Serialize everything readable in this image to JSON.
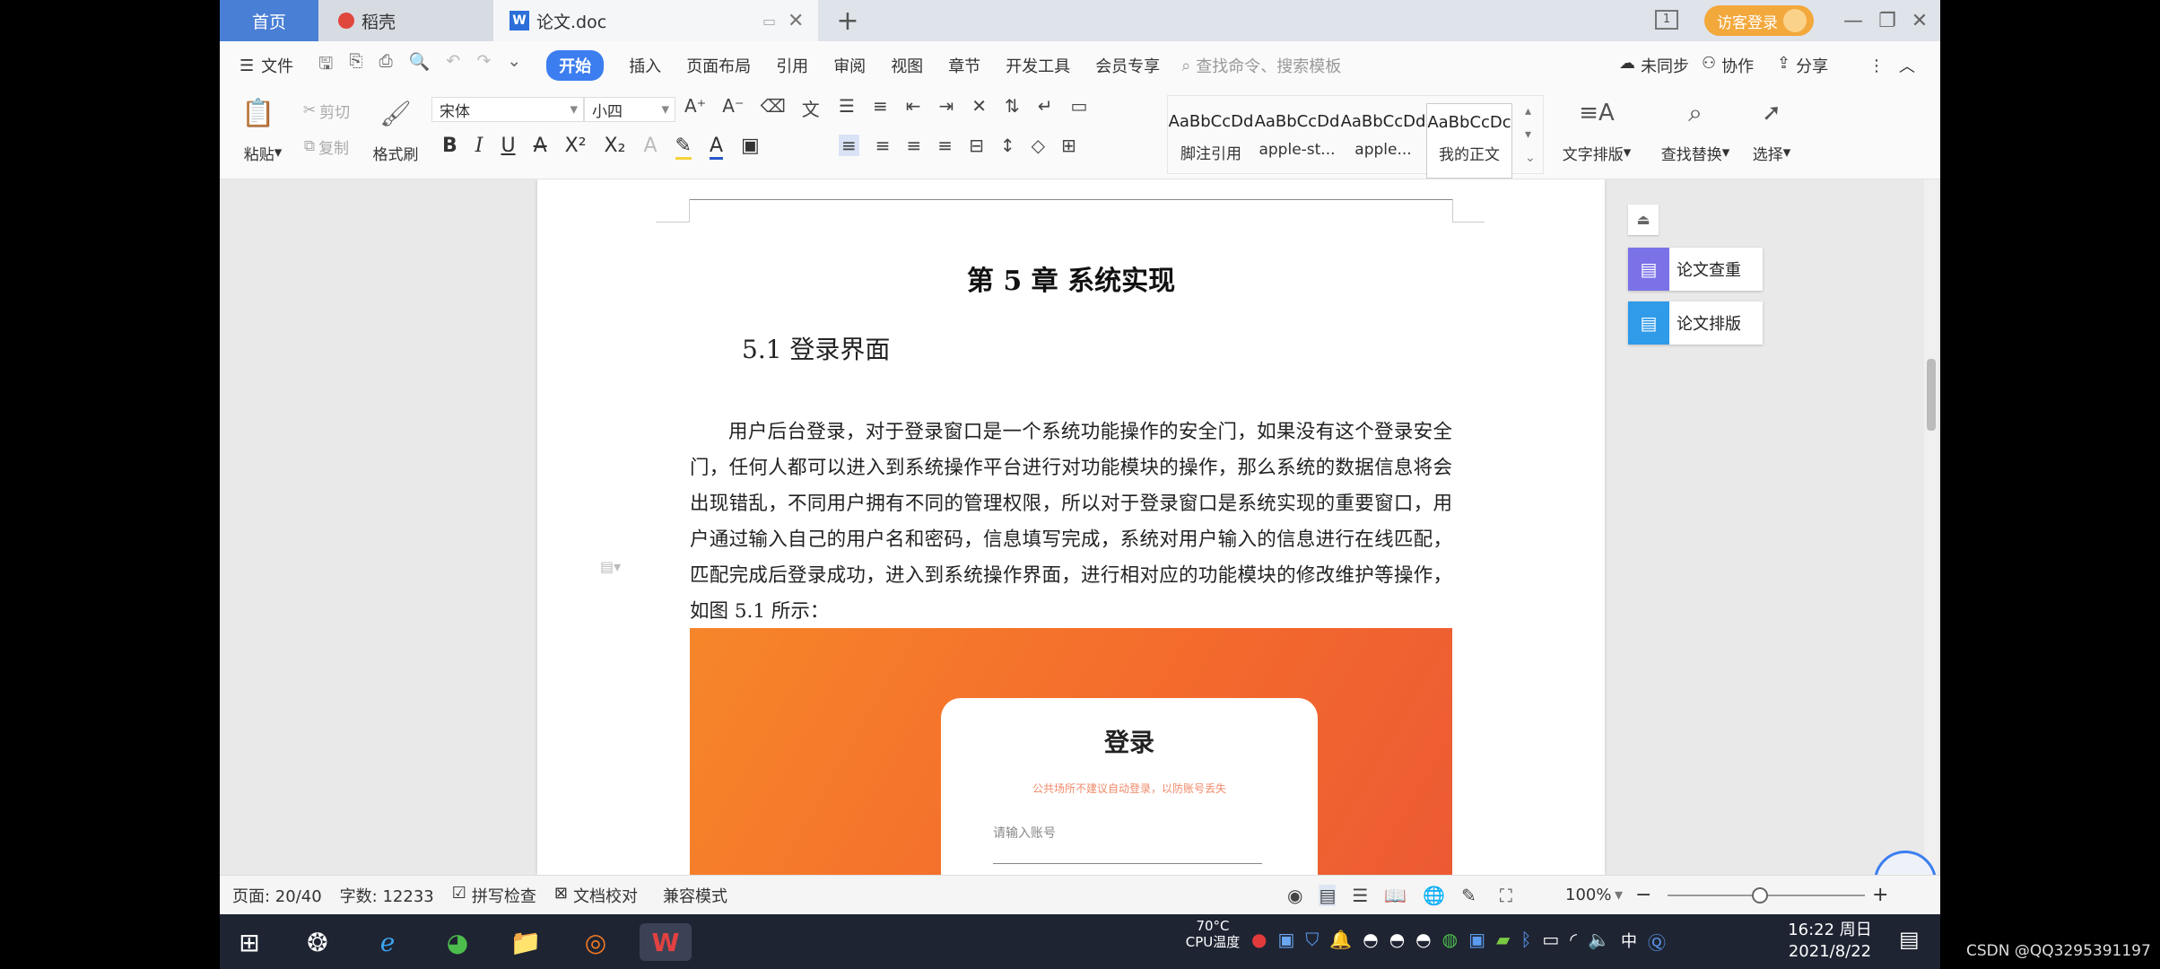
{
  "tabs": {
    "home": "首页",
    "daoke": "稻壳",
    "doc": "论文.doc"
  },
  "titlebar": {
    "login": "访客登录",
    "page_badge": "1"
  },
  "menu": {
    "file": "文件",
    "items": [
      "开始",
      "插入",
      "页面布局",
      "引用",
      "审阅",
      "视图",
      "章节",
      "开发工具",
      "会员专享"
    ],
    "search_placeholder": "查找命令、搜索模板",
    "unsynced": "未同步",
    "collab": "协作",
    "share": "分享"
  },
  "ribbon": {
    "paste": "粘贴",
    "cut": "剪切",
    "copy": "复制",
    "format_painter": "格式刷",
    "font_name": "宋体",
    "font_size": "小四",
    "styles": [
      {
        "sample": "AaBbCcDd",
        "name": "脚注引用"
      },
      {
        "sample": "AaBbCcDd",
        "name": "apple-st..."
      },
      {
        "sample": "AaBbCcDd",
        "name": "apple..."
      },
      {
        "sample": "AaBbCcDc",
        "name": "我的正文"
      }
    ],
    "text_layout": "文字排版",
    "find_replace": "查找替换",
    "select": "选择"
  },
  "document": {
    "chapter_title": "第 5 章  系统实现",
    "section_title": "5.1 登录界面",
    "paragraph": "用户后台登录，对于登录窗口是一个系统功能操作的安全门，如果没有这个登录安全门，任何人都可以进入到系统操作平台进行对功能模块的操作，那么系统的数据信息将会出现错乱，不同用户拥有不同的管理权限，所以对于登录窗口是系统实现的重要窗口，用户通过输入自己的用户名和密码，信息填写完成，系统对用户输入的信息进行在线匹配，匹配完成后登录成功，进入到系统操作界面，进行相对应的功能模块的修改维护等操作，如图 5.1 所示：",
    "figure": {
      "login_title": "登录",
      "login_hint": "公共场所不建议自动登录，以防账号丢失",
      "input_placeholder": "请输入账号"
    }
  },
  "sidepanel": {
    "check": "论文查重",
    "format": "论文排版"
  },
  "status": {
    "page": "页面: 20/40",
    "words": "字数: 12233",
    "spell": "拼写检查",
    "proof": "文档校对",
    "compat": "兼容模式",
    "zoom": "100%"
  },
  "taskbar": {
    "time": "16:22 周日",
    "date": "2021/8/22",
    "temp": "70°C",
    "cpu": "CPU温度",
    "ime": "中"
  },
  "watermark": "CSDN @QQ3295391197"
}
